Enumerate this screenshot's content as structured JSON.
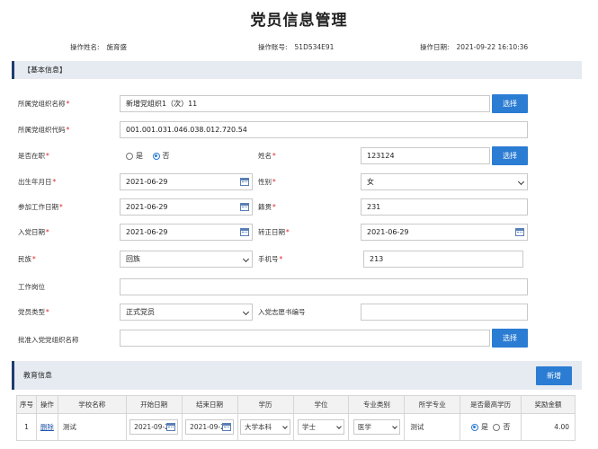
{
  "page_title": "党员信息管理",
  "meta": {
    "operator_label": "操作姓名:",
    "operator_value": "施育盛",
    "account_label": "操作账号:",
    "account_value": "51D534E91",
    "date_label": "操作日期:",
    "date_value": "2021-09-22 16:10:36"
  },
  "basic_section": {
    "title": "【基本信息】"
  },
  "form": {
    "org_name": {
      "label": "所属党组织名称",
      "value": "新增党组织1（次）11",
      "button": "选择"
    },
    "org_code": {
      "label": "所属党组织代码",
      "value": "001.001.031.046.038.012.720.54"
    },
    "employed": {
      "label": "是否在职",
      "options": [
        "是",
        "否"
      ],
      "selected": "否"
    },
    "name": {
      "label": "姓名",
      "value": "123124",
      "button": "选择"
    },
    "birth_date": {
      "label": "出生年月日",
      "value": "2021-06-29"
    },
    "gender": {
      "label": "性别",
      "value": "女"
    },
    "work_date": {
      "label": "参加工作日期",
      "value": "2021-06-29"
    },
    "native_place": {
      "label": "籍贯",
      "value": "231"
    },
    "join_date": {
      "label": "入党日期",
      "value": "2021-06-29"
    },
    "formal_date": {
      "label": "转正日期",
      "value": "2021-06-29"
    },
    "ethnicity": {
      "label": "民族",
      "value": "回族"
    },
    "phone": {
      "label": "手机号",
      "value": "213"
    },
    "position": {
      "label": "工作岗位",
      "value": ""
    },
    "member_type": {
      "label": "党员类型",
      "value": "正式党员"
    },
    "application_no": {
      "label": "入党志愿书编号",
      "value": ""
    },
    "approve_org": {
      "label": "批准入党党组织名称",
      "value": "",
      "button": "选择"
    }
  },
  "edu_section": {
    "title": "教育信息",
    "add_button": "新增"
  },
  "edu_table": {
    "headers": [
      "序号",
      "操作",
      "学校名称",
      "开始日期",
      "结束日期",
      "学历",
      "学位",
      "专业类别",
      "所学专业",
      "是否最高学历",
      "奖励金额"
    ],
    "rows": [
      {
        "index": "1",
        "action": "删除",
        "school": "测试",
        "start": "2021-09-22",
        "end": "2021-09-22",
        "education": "大学本科",
        "degree": "学士",
        "major_type": "医学",
        "major": "测试",
        "highest_options": [
          "是",
          "否"
        ],
        "highest_selected": "是",
        "reward": "4.00"
      }
    ]
  },
  "colors": {
    "accent": "#2b7cd3",
    "section_bg": "#e6ebf2",
    "section_border": "#1f3c6e",
    "required": "#e02020"
  },
  "icons": [
    "calendar-icon",
    "chevron-down-icon"
  ]
}
